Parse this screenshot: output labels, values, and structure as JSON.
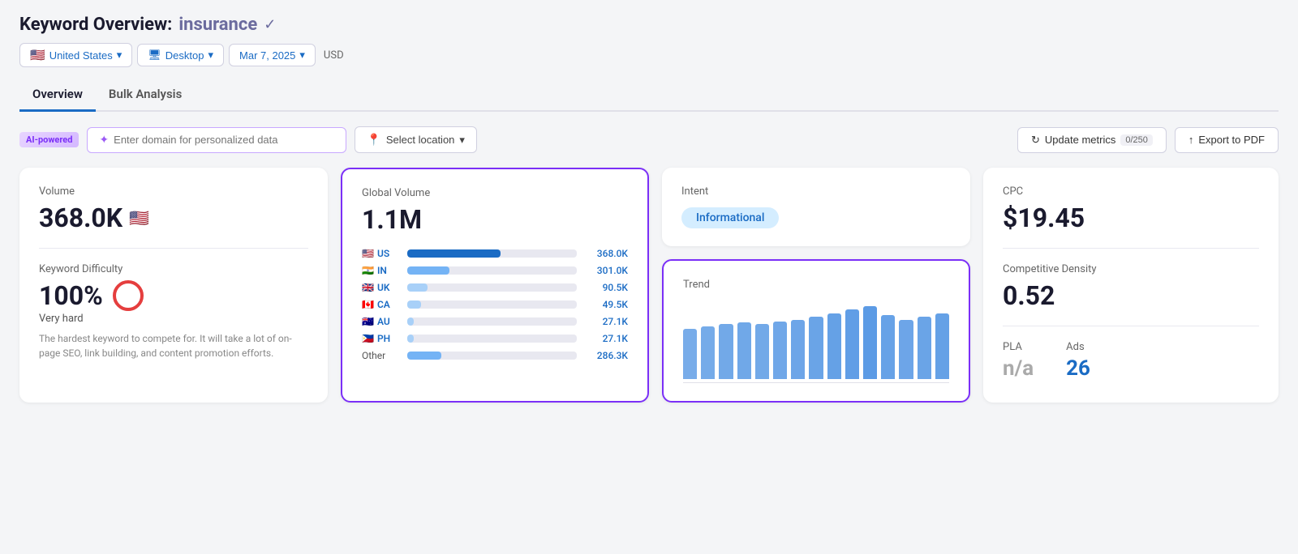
{
  "header": {
    "title": "Keyword Overview:",
    "keyword": "insurance",
    "verified": "✓"
  },
  "filters": {
    "country": "United States",
    "country_flag": "🇺🇸",
    "device": "Desktop",
    "date": "Mar 7, 2025",
    "currency": "USD"
  },
  "tabs": [
    {
      "label": "Overview",
      "active": true
    },
    {
      "label": "Bulk Analysis",
      "active": false
    }
  ],
  "toolbar": {
    "ai_badge": "AI-powered",
    "domain_placeholder": "Enter domain for personalized data",
    "location_label": "Select location",
    "update_label": "Update metrics",
    "update_count": "0/250",
    "export_label": "Export to PDF"
  },
  "volume_card": {
    "label": "Volume",
    "value": "368.0K",
    "flag": "🇺🇸",
    "difficulty_label": "Keyword Difficulty",
    "difficulty_value": "100%",
    "difficulty_sub": "Very hard",
    "difficulty_desc": "The hardest keyword to compete for. It will take a lot of on-page SEO, link building, and content promotion efforts."
  },
  "global_volume_card": {
    "label": "Global Volume",
    "value": "1.1M",
    "countries": [
      {
        "flag": "🇺🇸",
        "code": "US",
        "fill_pct": 55,
        "fill_type": "dark-blue",
        "value": "368.0K"
      },
      {
        "flag": "🇮🇳",
        "code": "IN",
        "fill_pct": 25,
        "fill_type": "light-blue",
        "value": "301.0K"
      },
      {
        "flag": "🇬🇧",
        "code": "UK",
        "fill_pct": 12,
        "fill_type": "medium-blue",
        "value": "90.5K"
      },
      {
        "flag": "🇨🇦",
        "code": "CA",
        "fill_pct": 8,
        "fill_type": "medium-blue",
        "value": "49.5K"
      },
      {
        "flag": "🇦🇺",
        "code": "AU",
        "fill_pct": 4,
        "fill_type": "medium-blue",
        "value": "27.1K"
      },
      {
        "flag": "🇵🇭",
        "code": "PH",
        "fill_pct": 4,
        "fill_type": "medium-blue",
        "value": "27.1K"
      }
    ],
    "other_label": "Other",
    "other_fill_pct": 20,
    "other_value": "286.3K"
  },
  "intent_card": {
    "label": "Intent",
    "badge": "Informational"
  },
  "trend_card": {
    "label": "Trend",
    "bars": [
      55,
      58,
      60,
      62,
      60,
      63,
      65,
      68,
      72,
      76,
      80,
      70,
      65,
      68,
      72
    ]
  },
  "metrics_card": {
    "cpc_label": "CPC",
    "cpc_value": "$19.45",
    "comp_label": "Competitive Density",
    "comp_value": "0.52",
    "pla_label": "PLA",
    "pla_value": "n/a",
    "ads_label": "Ads",
    "ads_value": "26"
  }
}
